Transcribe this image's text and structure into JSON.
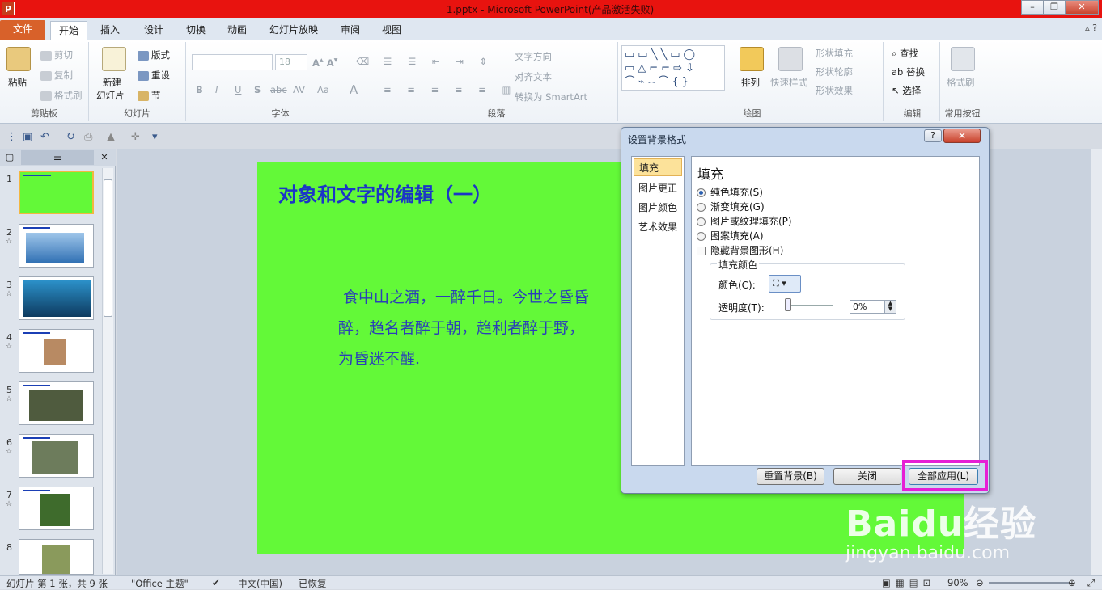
{
  "window": {
    "title": "1.pptx - Microsoft PowerPoint(产品激活失败)",
    "app_icon": "P"
  },
  "tabs": [
    "文件",
    "开始",
    "插入",
    "设计",
    "切换",
    "动画",
    "幻灯片放映",
    "审阅",
    "视图"
  ],
  "ribbon": {
    "clipboard": {
      "paste": "粘贴",
      "cut": "剪切",
      "copy": "复制",
      "format_painter": "格式刷",
      "label": "剪贴板"
    },
    "slides": {
      "new_slide": "新建",
      "new_slide2": "幻灯片",
      "layout": "版式",
      "reset": "重设",
      "section": "节",
      "label": "幻灯片"
    },
    "font": {
      "size": "18",
      "bold": "B",
      "italic": "I",
      "underline": "U",
      "shadow": "S",
      "strike": "abc",
      "spacing": "AV",
      "case": "Aa",
      "color": "A",
      "label": "字体"
    },
    "paragraph": {
      "text_direction": "文字方向",
      "align_text": "对齐文本",
      "smartart": "转换为 SmartArt",
      "label": "段落"
    },
    "drawing": {
      "arrange": "排列",
      "quick_styles": "快速样式",
      "shape_fill": "形状填充",
      "shape_outline": "形状轮廓",
      "shape_effects": "形状效果",
      "label": "绘图"
    },
    "editing": {
      "find": "查找",
      "replace": "替换",
      "select": "选择",
      "label": "编辑"
    },
    "common": {
      "format_painter": "格式刷",
      "label": "常用按钮"
    }
  },
  "slides": [
    {
      "num": "1",
      "star": ""
    },
    {
      "num": "2",
      "star": "☆"
    },
    {
      "num": "3",
      "star": "☆"
    },
    {
      "num": "4",
      "star": "☆"
    },
    {
      "num": "5",
      "star": "☆"
    },
    {
      "num": "6",
      "star": "☆"
    },
    {
      "num": "7",
      "star": "☆"
    },
    {
      "num": "8",
      "star": ""
    }
  ],
  "slide": {
    "title": "对象和文字的编辑（一）",
    "body_line1": "食中山之酒，一醉千日。今世之昏昏",
    "body_line2": "醉，趋名者醉于朝，趋利者醉于野，",
    "body_line3": "为昏迷不醒."
  },
  "dialog": {
    "title": "设置背景格式",
    "help": "?",
    "nav": [
      "填充",
      "图片更正",
      "图片颜色",
      "艺术效果"
    ],
    "heading": "填充",
    "options": [
      "纯色填充(S)",
      "渐变填充(G)",
      "图片或纹理填充(P)",
      "图案填充(A)"
    ],
    "hide_bg": "隐藏背景图形(H)",
    "fill_color_group": "填充颜色",
    "color_label": "颜色(C):",
    "transparency_label": "透明度(T):",
    "transparency_value": "0%",
    "buttons": {
      "reset": "重置背景(B)",
      "close": "关闭",
      "apply_all": "全部应用(L)"
    }
  },
  "status": {
    "slide_info": "幻灯片 第 1 张，共 9 张",
    "theme": "\"Office 主题\"",
    "language": "中文(中国)",
    "recovered": "已恢复",
    "zoom": "90%"
  },
  "watermark": {
    "main": "Baidu经验",
    "sub": "jingyan.baidu.com"
  },
  "colors": {
    "slide_bg": "#63f938",
    "title_bar": "#e8130f",
    "highlight": "#e61fd5",
    "file_tab": "#d8612a"
  }
}
